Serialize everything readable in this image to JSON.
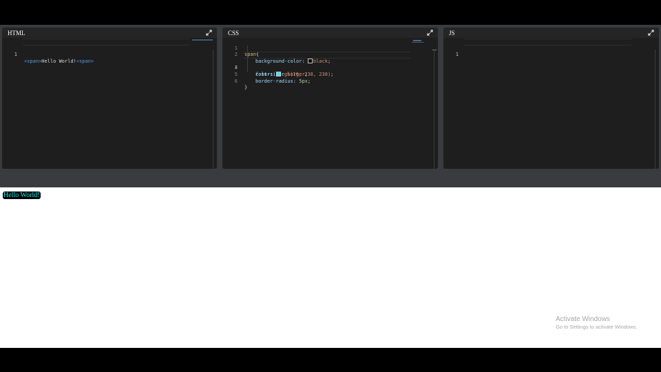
{
  "panels": {
    "html": {
      "title": "HTML",
      "lines": [
        {
          "n": "1",
          "open_tag": "<span>",
          "text": "Hello World!",
          "close_tag": "<span>"
        }
      ]
    },
    "css": {
      "title": "CSS",
      "lines": [
        {
          "n": "1",
          "selector": "span",
          "brace": "{"
        },
        {
          "n": "2",
          "prop": "background-color",
          "sep": ": ",
          "value": "black",
          "end": ";"
        },
        {
          "n": "3",
          "prop": "color",
          "sep": ": ",
          "value": "rgb(10, 238, 238)",
          "end": ";"
        },
        {
          "n": "4",
          "prop": "font-size",
          "sep": ": ",
          "value": "larger",
          "end": ";"
        },
        {
          "n": "5",
          "prop": "border-radius",
          "sep": ": ",
          "value": "5px",
          "end": ";"
        },
        {
          "n": "6",
          "brace": "}"
        }
      ],
      "swatch_colors": {
        "black": "#000000",
        "aqua": "#0aeeee"
      }
    },
    "js": {
      "title": "JS",
      "lines": [
        {
          "n": "1"
        }
      ]
    }
  },
  "icons": {
    "expand": "expand-arrows-icon"
  },
  "preview": {
    "text": "Hello World!",
    "background": "#000000",
    "color": "#0aeeee"
  },
  "watermark": {
    "title": "Activate Windows",
    "subtitle": "Go to Settings to activate Windows."
  }
}
